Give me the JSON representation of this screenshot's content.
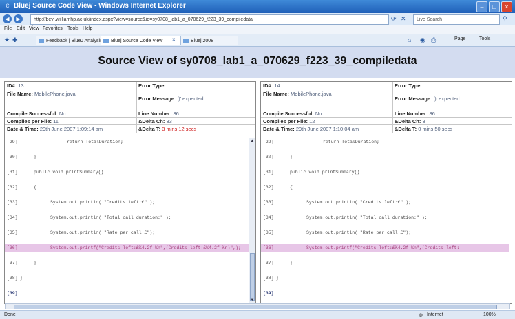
{
  "window": {
    "title": "Bluej Source Code View - Windows Internet Explorer",
    "controls": [
      "–",
      "□",
      "×"
    ]
  },
  "browser": {
    "address": "http://bevi.williamhp.ac.uk/index.aspx?view=source&id=sy0708_lab1_a_070629_f223_39_compiledata",
    "search_placeholder": "Live Search",
    "menu": [
      "File",
      "Edit",
      "View",
      "Favorites",
      "Tools",
      "Help"
    ],
    "tabs": [
      "Feedback | BlueJ Analysis",
      "Bluej Source Code View",
      "Bluej 2008"
    ],
    "tools": [
      "Page",
      "Tools"
    ]
  },
  "page": {
    "heading": "Source View of sy0708_lab1_a_070629_f223_39_compiledata"
  },
  "panels": [
    {
      "id_label": "ID#:",
      "id": "13",
      "error_type_label": "Error Type:",
      "error_type": "",
      "file_label": "File Name:",
      "file": "MobilePhone.java",
      "error_message_label": "Error Message:",
      "error_message": "')' expected",
      "compile_label": "Compile Successful:",
      "compile": "No",
      "line_label": "Line Number:",
      "line": "36",
      "cpf_label": "Compiles per File:",
      "cpf": "11",
      "dch_label": "&Delta Ch:",
      "dch": "33",
      "dt_label": "Date & Time:",
      "dt": "29th June 2007 1:09:14 am",
      "dtt_label": "&Delta T:",
      "dtt": "3 mins 12 secs",
      "code": [
        {
          "n": "[29]",
          "t": "return TotalDuration;"
        },
        {
          "n": "[30]",
          "t": "}"
        },
        {
          "n": "[31]",
          "t": "public void printSummary()"
        },
        {
          "n": "[32]",
          "t": "{"
        },
        {
          "n": "[33]",
          "t": "System.out.println( \"Credits left:£\" );"
        },
        {
          "n": "[34]",
          "t": "System.out.println( \"Total call duration:\" );"
        },
        {
          "n": "[35]",
          "t": "System.out.println( \"Rate per call:£\");"
        },
        {
          "n": "[36]",
          "t": "System.out.printf(\"Credits left:£%4.2f %n\",(Credits left:£%4.2f %n)\",);"
        },
        {
          "n": "[37]",
          "t": "}"
        },
        {
          "n": "[38]",
          "t": "}"
        },
        {
          "n": "[39]",
          "t": ""
        }
      ]
    },
    {
      "id_label": "ID#:",
      "id": "14",
      "error_type_label": "Error Type:",
      "error_type": "",
      "file_label": "File Name:",
      "file": "MobilePhone.java",
      "error_message_label": "Error Message:",
      "error_message": "')' expected",
      "compile_label": "Compile Successful:",
      "compile": "No",
      "line_label": "Line Number:",
      "line": "36",
      "cpf_label": "Compiles per File:",
      "cpf": "12",
      "dch_label": "&Delta Ch:",
      "dch": "3",
      "dt_label": "Date & Time:",
      "dt": "29th June 2007 1:10:04 am",
      "dtt_label": "&Delta T:",
      "dtt": "0 mins 50 secs",
      "code": [
        {
          "n": "[29]",
          "t": "return TotalDuration;"
        },
        {
          "n": "[30]",
          "t": "}"
        },
        {
          "n": "[31]",
          "t": "public void printSummary()"
        },
        {
          "n": "[32]",
          "t": "{"
        },
        {
          "n": "[33]",
          "t": "System.out.println( \"Credits left:£\" );"
        },
        {
          "n": "[34]",
          "t": "System.out.println( \"Total call duration:\" );"
        },
        {
          "n": "[35]",
          "t": "System.out.println( \"Rate per call:£\");"
        },
        {
          "n": "[36]",
          "t": "System.out.printf(\"Credits left:£%4.2f %n\",(Credits left:"
        },
        {
          "n": "[37]",
          "t": "}"
        },
        {
          "n": "[38]",
          "t": "}"
        },
        {
          "n": "[39]",
          "t": ""
        }
      ]
    }
  ],
  "status": {
    "left": "Done",
    "zone": "Internet",
    "zoom": "100%"
  }
}
